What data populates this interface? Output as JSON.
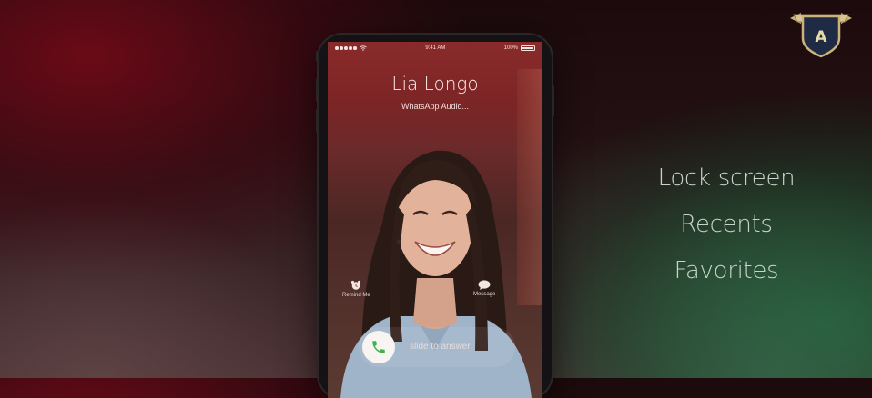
{
  "phone": {
    "status_bar": {
      "time": "9:41 AM",
      "battery": "100%"
    },
    "caller_name": "Lia Longo",
    "call_type": "WhatsApp Audio...",
    "actions": {
      "remind": "Remind Me",
      "message": "Message"
    },
    "slider_label": "slide to answer"
  },
  "features": [
    {
      "label": "Lock screen"
    },
    {
      "label": "Recents"
    },
    {
      "label": "Favorites"
    }
  ],
  "badge": {
    "letter": "A"
  },
  "colors": {
    "accept_green": "#3fb34f",
    "badge_navy": "#1f2b45",
    "badge_gold": "#c9b27c"
  },
  "icons": [
    "phone-icon",
    "alarm-icon",
    "message-icon",
    "wifi-icon",
    "battery-icon"
  ]
}
